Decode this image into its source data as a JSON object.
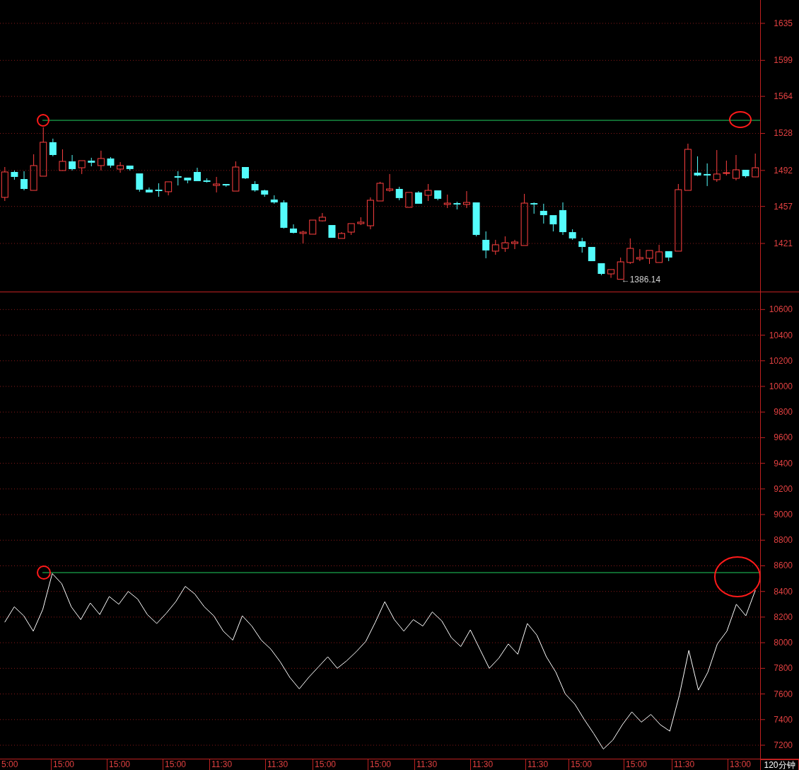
{
  "price_panel": {
    "chart_data": {
      "type": "candlestick",
      "grid": true,
      "ylim": [
        1374.2,
        1657.7
      ],
      "yticks": [
        1635,
        1599,
        1564,
        1528,
        1492,
        1457,
        1421
      ],
      "ref_lines": [
        {
          "axis": "y",
          "value": 1540.7,
          "color": "#20d060"
        }
      ],
      "ohlc": [
        [
          1465.8,
          1495.3,
          1462.3,
          1490.5
        ],
        [
          1490.5,
          1491.9,
          1483.0,
          1485.7
        ],
        [
          1483.6,
          1491.2,
          1472.6,
          1474.0
        ],
        [
          1472.6,
          1507.7,
          1472.6,
          1496.7
        ],
        [
          1486.4,
          1533.9,
          1486.4,
          1519.4
        ],
        [
          1519.4,
          1522.9,
          1505.7,
          1507.0
        ],
        [
          1491.9,
          1512.5,
          1491.9,
          1500.8
        ],
        [
          1500.8,
          1507.0,
          1491.9,
          1493.3
        ],
        [
          1494.6,
          1501.5,
          1488.5,
          1501.5
        ],
        [
          1501.5,
          1504.3,
          1496.0,
          1499.5
        ],
        [
          1496.7,
          1511.2,
          1491.9,
          1503.6
        ],
        [
          1503.6,
          1505.0,
          1494.6,
          1496.7
        ],
        [
          1493.3,
          1500.1,
          1489.8,
          1496.7
        ],
        [
          1496.7,
          1496.7,
          1491.9,
          1493.3
        ],
        [
          1489.1,
          1489.1,
          1471.3,
          1473.3
        ],
        [
          1473.3,
          1475.4,
          1470.6,
          1470.6
        ],
        [
          1473.3,
          1479.5,
          1466.4,
          1471.9
        ],
        [
          1471.3,
          1480.9,
          1467.8,
          1480.9
        ],
        [
          1486.4,
          1491.2,
          1477.4,
          1485.0
        ],
        [
          1485.0,
          1485.0,
          1479.5,
          1482.3
        ],
        [
          1490.5,
          1494.6,
          1481.6,
          1481.6
        ],
        [
          1482.3,
          1484.3,
          1480.2,
          1480.9
        ],
        [
          1477.4,
          1485.7,
          1470.6,
          1478.8
        ],
        [
          1478.8,
          1478.8,
          1476.1,
          1477.4
        ],
        [
          1471.9,
          1500.8,
          1471.9,
          1495.3
        ],
        [
          1495.3,
          1495.3,
          1483.6,
          1484.3
        ],
        [
          1478.8,
          1481.6,
          1471.3,
          1472.6
        ],
        [
          1472.6,
          1473.3,
          1466.4,
          1468.5
        ],
        [
          1463.7,
          1467.8,
          1459.6,
          1460.9
        ],
        [
          1460.9,
          1463.0,
          1435.5,
          1436.2
        ],
        [
          1435.5,
          1439.6,
          1430.7,
          1431.3
        ],
        [
          1430.7,
          1433.4,
          1421.0,
          1432.0
        ],
        [
          1430.0,
          1443.7,
          1430.0,
          1443.7
        ],
        [
          1443.0,
          1450.6,
          1442.4,
          1446.5
        ],
        [
          1438.9,
          1438.9,
          1426.5,
          1426.5
        ],
        [
          1425.9,
          1432.0,
          1425.9,
          1430.7
        ],
        [
          1432.0,
          1440.3,
          1429.3,
          1440.3
        ],
        [
          1440.3,
          1446.5,
          1438.9,
          1441.7
        ],
        [
          1438.2,
          1465.8,
          1434.8,
          1463.0
        ],
        [
          1462.3,
          1480.9,
          1462.3,
          1479.5
        ],
        [
          1472.6,
          1488.5,
          1471.3,
          1474.0
        ],
        [
          1474.0,
          1476.1,
          1463.0,
          1465.1
        ],
        [
          1456.1,
          1470.6,
          1456.1,
          1470.6
        ],
        [
          1470.6,
          1471.9,
          1459.6,
          1459.6
        ],
        [
          1467.8,
          1478.8,
          1462.3,
          1472.6
        ],
        [
          1472.6,
          1472.6,
          1463.0,
          1464.4
        ],
        [
          1458.9,
          1468.5,
          1455.4,
          1460.2
        ],
        [
          1460.2,
          1461.6,
          1454.1,
          1458.9
        ],
        [
          1458.9,
          1471.9,
          1455.4,
          1460.9
        ],
        [
          1460.9,
          1460.9,
          1427.9,
          1429.3
        ],
        [
          1424.5,
          1432.7,
          1406.6,
          1414.2
        ],
        [
          1413.5,
          1424.5,
          1410.0,
          1419.7
        ],
        [
          1416.2,
          1427.9,
          1412.8,
          1421.7
        ],
        [
          1421.0,
          1424.5,
          1415.5,
          1422.4
        ],
        [
          1419.0,
          1469.2,
          1419.0,
          1460.2
        ],
        [
          1460.2,
          1460.9,
          1449.9,
          1458.9
        ],
        [
          1452.7,
          1459.6,
          1440.3,
          1448.5
        ],
        [
          1448.5,
          1448.5,
          1432.7,
          1439.6
        ],
        [
          1453.4,
          1460.9,
          1429.3,
          1432.0
        ],
        [
          1432.0,
          1434.8,
          1424.5,
          1425.9
        ],
        [
          1423.1,
          1426.5,
          1412.1,
          1417.6
        ],
        [
          1417.6,
          1417.6,
          1403.8,
          1403.8
        ],
        [
          1401.8,
          1401.8,
          1390.1,
          1391.4
        ],
        [
          1391.4,
          1395.6,
          1387.5,
          1395.6
        ],
        [
          1386.14,
          1407.3,
          1386.14,
          1403.1
        ],
        [
          1402.5,
          1425.9,
          1401.1,
          1416.2
        ],
        [
          1405.9,
          1415.5,
          1403.8,
          1407.3
        ],
        [
          1406.6,
          1414.2,
          1401.1,
          1414.2
        ],
        [
          1402.5,
          1419.7,
          1402.5,
          1412.8
        ],
        [
          1413.5,
          1413.5,
          1403.8,
          1407.3
        ],
        [
          1413.5,
          1478.8,
          1413.5,
          1473.3
        ],
        [
          1472.6,
          1518.0,
          1472.6,
          1512.5
        ],
        [
          1489.8,
          1505.7,
          1486.4,
          1487.1
        ],
        [
          1488.5,
          1498.8,
          1476.8,
          1487.1
        ],
        [
          1483.0,
          1511.8,
          1480.9,
          1488.5
        ],
        [
          1489.1,
          1501.5,
          1487.1,
          1489.8
        ],
        [
          1484.3,
          1507.0,
          1482.3,
          1492.6
        ],
        [
          1492.6,
          1492.6,
          1485.0,
          1486.4
        ],
        [
          1485.7,
          1508.4,
          1485.7,
          1494.6
        ]
      ],
      "annotations": [
        "←1386.14"
      ]
    }
  },
  "indicator_panel": {
    "chart_data": {
      "type": "line",
      "grid": true,
      "ylim": [
        7095,
        10740
      ],
      "yticks": [
        10600,
        10400,
        10200,
        10000,
        9800,
        9600,
        9400,
        9200,
        9000,
        8800,
        8600,
        8400,
        8200,
        8000,
        7800,
        7600,
        7400,
        7200
      ],
      "ref_lines": [
        {
          "axis": "y",
          "value": 8547,
          "color": "#20d060"
        }
      ],
      "values": [
        8160,
        8280,
        8210,
        8090,
        8260,
        8540,
        8460,
        8280,
        8180,
        8310,
        8220,
        8360,
        8300,
        8400,
        8340,
        8220,
        8150,
        8230,
        8320,
        8440,
        8380,
        8280,
        8210,
        8090,
        8020,
        8210,
        8130,
        8020,
        7950,
        7850,
        7730,
        7640,
        7730,
        7810,
        7890,
        7800,
        7860,
        7930,
        8010,
        8160,
        8320,
        8180,
        8090,
        8180,
        8130,
        8240,
        8170,
        8040,
        7970,
        8100,
        7950,
        7800,
        7880,
        7990,
        7910,
        8150,
        8060,
        7890,
        7770,
        7600,
        7520,
        7400,
        7290,
        7170,
        7240,
        7360,
        7460,
        7380,
        7440,
        7360,
        7310,
        7590,
        7940,
        7630,
        7770,
        7990,
        8090,
        8300,
        8210,
        8410
      ]
    }
  },
  "time_axis": {
    "labels": [
      "5:00",
      "15:00",
      "15:00",
      "15:00",
      "11:30",
      "11:30",
      "15:00",
      "15:00",
      "11:30",
      "11:30",
      "11:30",
      "15:00",
      "15:00",
      "11:30",
      "13:00"
    ],
    "period": "120分钟"
  }
}
